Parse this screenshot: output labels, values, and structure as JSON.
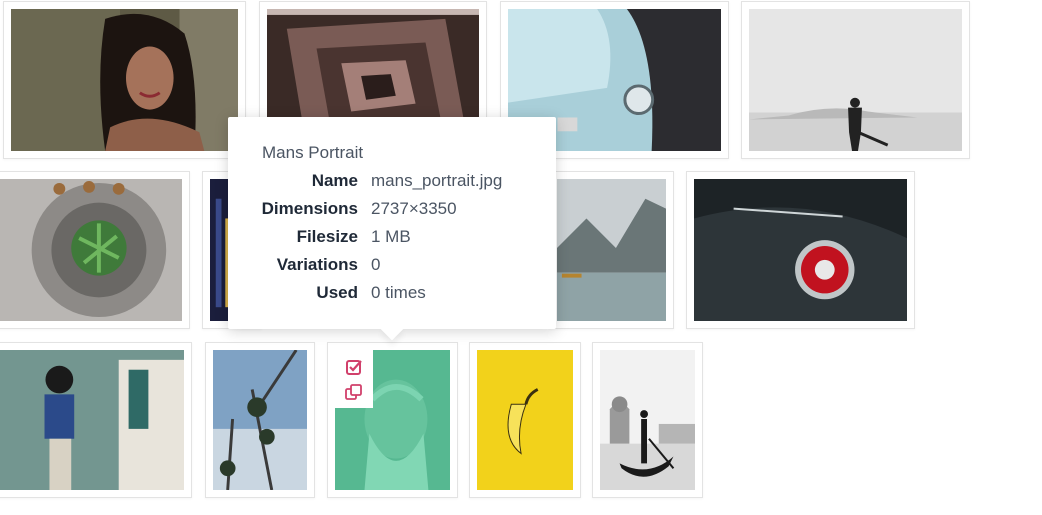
{
  "tooltip": {
    "title": "Mans Portrait",
    "rows": [
      {
        "key": "Name",
        "value": "mans_portrait.jpg"
      },
      {
        "key": "Dimensions",
        "value": "2737×3350"
      },
      {
        "key": "Filesize",
        "value": "1 MB"
      },
      {
        "key": "Variations",
        "value": "0"
      },
      {
        "key": "Used",
        "value": "0 times"
      }
    ]
  },
  "images": [
    {
      "subject": "woman portrait"
    },
    {
      "subject": "spiral stairwell"
    },
    {
      "subject": "vintage blue car"
    },
    {
      "subject": "guitarist in desert"
    },
    {
      "subject": "spiral staircase with plant"
    },
    {
      "subject": "city at night"
    },
    {
      "subject": "mountain lake"
    },
    {
      "subject": "classic car taillight"
    },
    {
      "subject": "woman at train"
    },
    {
      "subject": "palm trees"
    },
    {
      "subject": "old man portrait",
      "selected": true
    },
    {
      "subject": "banana on yellow"
    },
    {
      "subject": "venice gondola"
    }
  ],
  "actions": {
    "select_icon": "checkbox-checked-icon",
    "duplicate_icon": "duplicate-icon",
    "accent_color": "#d1406b"
  }
}
